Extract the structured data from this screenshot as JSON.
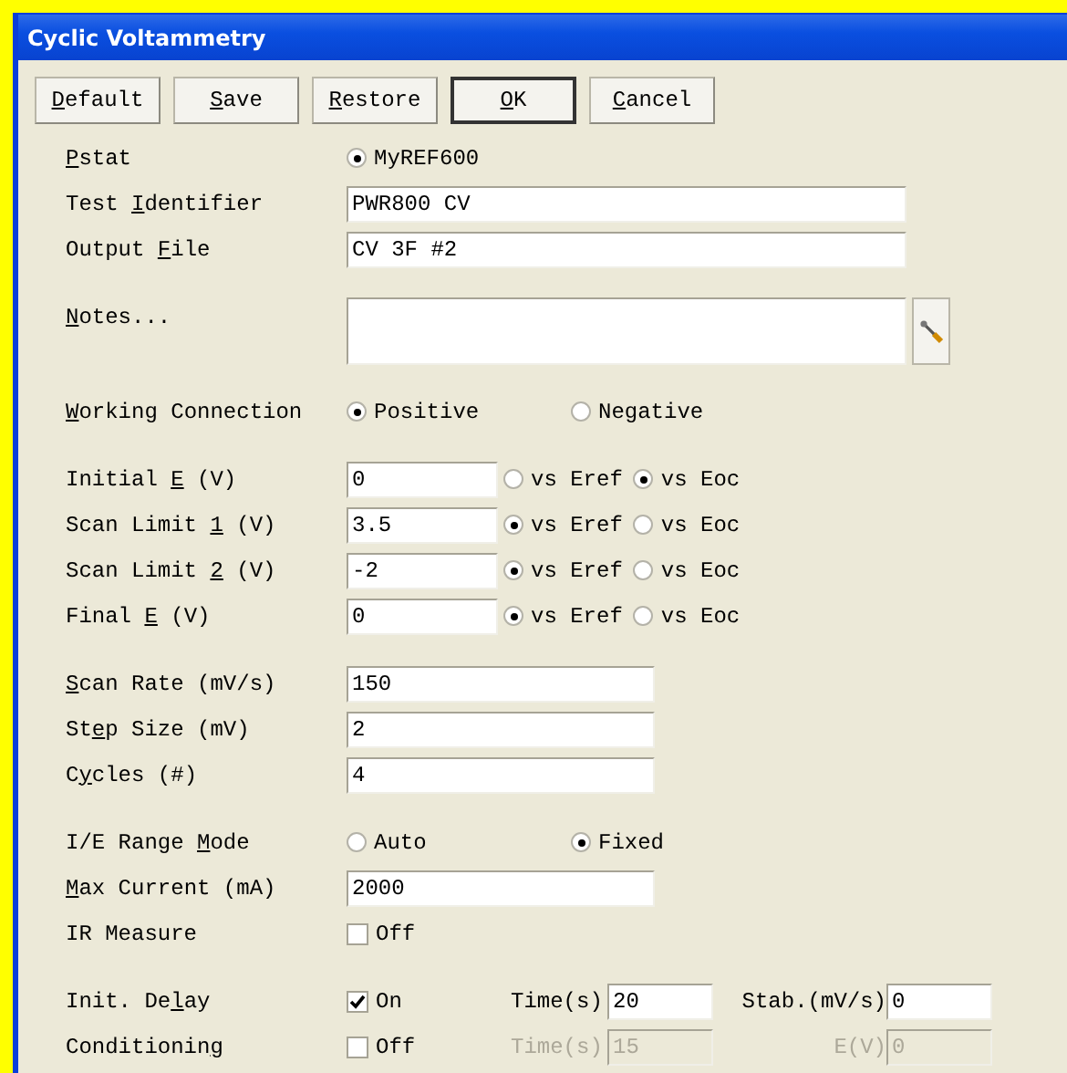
{
  "window": {
    "title": "Cyclic Voltammetry"
  },
  "buttons": [
    {
      "key": "D",
      "post": "efault",
      "default": false
    },
    {
      "key": "S",
      "post": "ave",
      "default": false
    },
    {
      "key": "R",
      "post": "estore",
      "default": false
    },
    {
      "key": "O",
      "post": "K",
      "default": true
    },
    {
      "key": "C",
      "post": "ancel",
      "default": false
    }
  ],
  "sections": [
    [
      {
        "kind": "radios",
        "key": "P",
        "post": "stat",
        "options": [
          {
            "label": "MyREF600",
            "selected": true
          }
        ]
      },
      {
        "kind": "entry",
        "pre": "Test ",
        "key": "I",
        "post": "dentifier",
        "value": "PWR800 CV"
      },
      {
        "kind": "entry",
        "pre": "Output ",
        "key": "F",
        "post": "ile",
        "value": "CV 3F #2"
      }
    ],
    [
      {
        "kind": "notes",
        "key": "N",
        "post": "otes..."
      }
    ],
    [
      {
        "kind": "radios",
        "key": "W",
        "post": "orking Connection",
        "options": [
          {
            "label": "Positive",
            "selected": true
          },
          {
            "label": "Negative",
            "selected": false
          }
        ]
      }
    ],
    [
      {
        "kind": "potential",
        "pre": "Initial ",
        "key": "E",
        "post": " (V)",
        "value": "0",
        "options": [
          {
            "label": "vs Eref",
            "selected": false
          },
          {
            "label": "vs Eoc",
            "selected": true
          }
        ]
      },
      {
        "kind": "potential",
        "pre": "Scan Limit ",
        "key": "1",
        "post": " (V)",
        "value": "3.5",
        "options": [
          {
            "label": "vs Eref",
            "selected": true
          },
          {
            "label": "vs Eoc",
            "selected": false
          }
        ]
      },
      {
        "kind": "potential",
        "pre": "Scan Limit ",
        "key": "2",
        "post": " (V)",
        "value": "-2",
        "options": [
          {
            "label": "vs Eref",
            "selected": true
          },
          {
            "label": "vs Eoc",
            "selected": false
          }
        ]
      },
      {
        "kind": "potential",
        "pre": "Final ",
        "key": "E",
        "post": " (V)",
        "value": "0",
        "options": [
          {
            "label": "vs Eref",
            "selected": true
          },
          {
            "label": "vs Eoc",
            "selected": false
          }
        ]
      }
    ],
    [
      {
        "kind": "number",
        "key": "S",
        "post": "can Rate (mV/s)",
        "value": "150"
      },
      {
        "kind": "number",
        "pre": "St",
        "key": "e",
        "post": "p Size (mV)",
        "value": "2"
      },
      {
        "kind": "number",
        "pre": "C",
        "key": "y",
        "post": "cles (#)",
        "value": "4"
      }
    ],
    [
      {
        "kind": "radios",
        "pre": "I/E Range ",
        "key": "M",
        "post": "ode",
        "options": [
          {
            "label": "Auto",
            "selected": false
          },
          {
            "label": "Fixed",
            "selected": true
          }
        ]
      },
      {
        "kind": "number",
        "key": "M",
        "post": "ax Current (mA)",
        "value": "2000"
      },
      {
        "kind": "check",
        "pre": "IR Measure",
        "checked": false,
        "text": "Off"
      }
    ],
    [
      {
        "kind": "timer",
        "pre": "Init. De",
        "key": "l",
        "post": "ay",
        "checked": true,
        "text": "On",
        "disabled": false,
        "time_label": "Time(s)",
        "time_value": "20",
        "extra_label": "Stab.(mV/s)",
        "extra_value": "0"
      },
      {
        "kind": "timer",
        "pre": "Conditionin",
        "key": "g",
        "checked": false,
        "text": "Off",
        "disabled": true,
        "time_label": "Time(s)",
        "time_value": "15",
        "extra_label": "E(V)",
        "extra_value": "0"
      }
    ]
  ]
}
